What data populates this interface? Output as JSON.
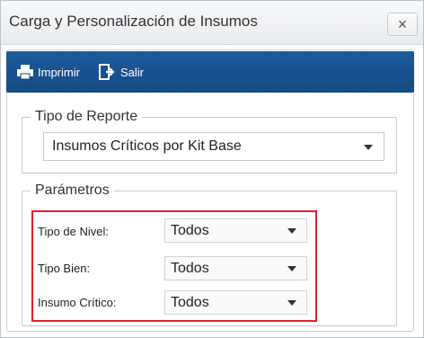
{
  "window": {
    "title": "Carga y Personalización de Insumos",
    "close_label": "×"
  },
  "toolbar": {
    "print_label": "Imprimir",
    "print_icon": "printer-icon",
    "exit_label": "Salir",
    "exit_icon": "exit-icon",
    "background_color": "#1c5b9a"
  },
  "report_type": {
    "legend": "Tipo de Reporte",
    "selected": "Insumos Críticos por Kit Base"
  },
  "parameters": {
    "legend": "Parámetros",
    "highlight_color": "#e0202a",
    "rows": [
      {
        "label": "Tipo de Nivel:",
        "value": "Todos"
      },
      {
        "label": "Tipo Bien:",
        "value": "Todos"
      },
      {
        "label": "Insumo Crítico:",
        "value": "Todos"
      }
    ]
  }
}
